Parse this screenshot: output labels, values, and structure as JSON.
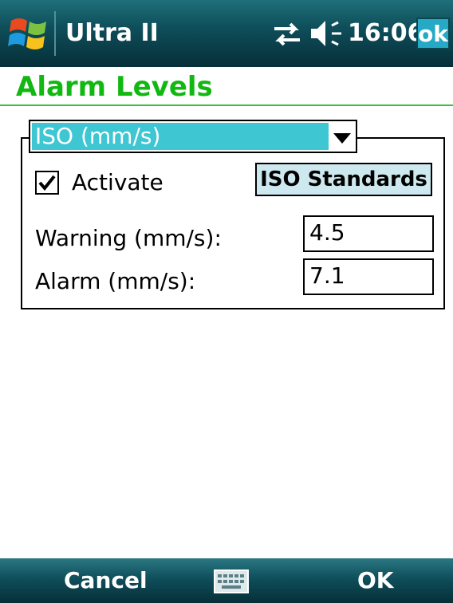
{
  "titlebar": {
    "app_title": "Ultra II",
    "time": "16:06",
    "ok_label": "ok",
    "icons": [
      "windows-start-icon",
      "connectivity-icon",
      "volume-icon"
    ]
  },
  "page": {
    "title": "Alarm Levels"
  },
  "settings": {
    "mode_select": {
      "selected": "ISO (mm/s)"
    },
    "activate": {
      "label": "Activate",
      "checked": true
    },
    "iso_button_label": "ISO Standards",
    "warning": {
      "label": "Warning (mm/s):",
      "value": "4.5"
    },
    "alarm": {
      "label": "Alarm (mm/s):",
      "value": "7.1"
    }
  },
  "softkeys": {
    "left": "Cancel",
    "right": "OK",
    "center_icon": "keyboard-icon"
  },
  "colors": {
    "title_green": "#12b812",
    "selection_cyan": "#3ec6d3",
    "button_fill": "#cde8ee",
    "bar_dark": "#0e4f5b"
  }
}
